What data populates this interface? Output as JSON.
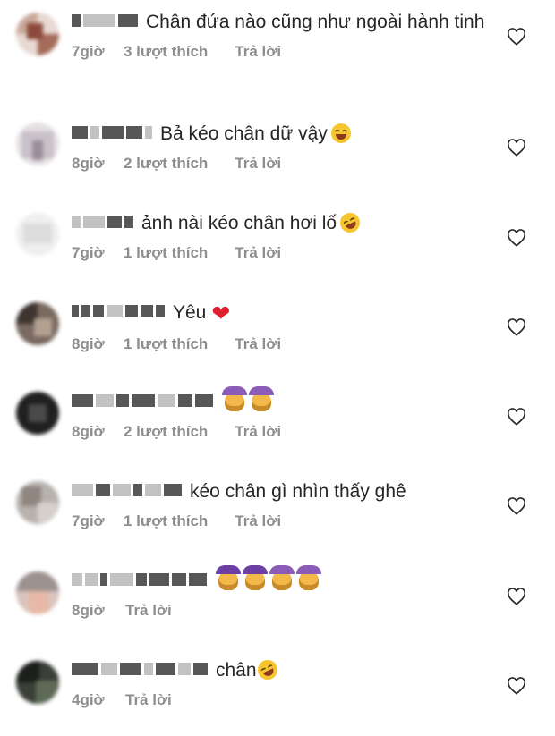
{
  "comments": [
    {
      "text": "Chân đứa nào cũng như ngoài hành tinh",
      "time": "7giờ",
      "likes": "3 lượt thích",
      "reply": "Trả lời"
    },
    {
      "text": "Bả kéo chân dữ vậy",
      "time": "8giờ",
      "likes": "2 lượt thích",
      "reply": "Trả lời",
      "emoji": "laughing-tears-emoji"
    },
    {
      "text": "ảnh nài kéo chân hơi lố",
      "time": "7giờ",
      "likes": "1 lượt thích",
      "reply": "Trả lời",
      "emoji": "rofl-emoji"
    },
    {
      "text": "Yêu",
      "time": "8giờ",
      "likes": "1 lượt thích",
      "reply": "Trả lời",
      "emoji": "red-heart-emoji"
    },
    {
      "text": "",
      "time": "8giờ",
      "likes": "2 lượt thích",
      "reply": "Trả lời",
      "emoji": "woman-gesturing-ok-emoji x2"
    },
    {
      "text": "kéo chân gì nhìn thấy ghê",
      "time": "7giờ",
      "likes": "1 lượt thích",
      "reply": "Trả lời"
    },
    {
      "text": "",
      "time": "8giờ",
      "likes": "",
      "reply": "Trả lời",
      "emoji": "woman-gesturing-ok-emoji x4"
    },
    {
      "text": "chân",
      "time": "4giờ",
      "likes": "",
      "reply": "Trả lời",
      "emoji": "rofl-emoji"
    }
  ],
  "icons": {
    "like": "heart-outline-icon"
  },
  "colors": {
    "text": "#262626",
    "meta": "#8e8e8e",
    "heart": "#e0202f"
  }
}
